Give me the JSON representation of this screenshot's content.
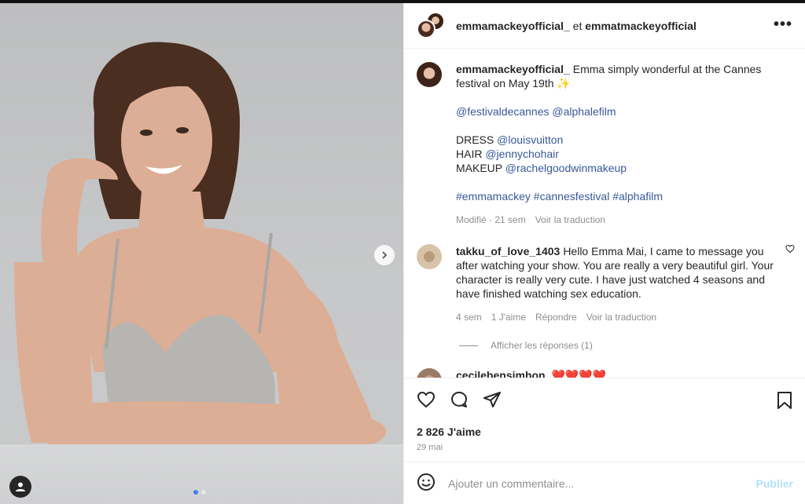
{
  "header": {
    "user1": "emmamackeyofficial_",
    "joiner": "et",
    "user2": "emmatmackeyofficial"
  },
  "caption": {
    "username": "emmamackeyofficial_",
    "text": "Emma simply wonderful at the Cannes festival on May 19th ✨",
    "mentions_line": [
      "@festivaldecannes",
      "@alphalefilm"
    ],
    "credits": [
      {
        "label": "DRESS",
        "handle": "@louisvuitton"
      },
      {
        "label": "HAIR",
        "handle": "@jennychohair"
      },
      {
        "label": "MAKEUP",
        "handle": "@rachelgoodwinmakeup"
      }
    ],
    "hashtags": "#emmamackey #cannesfestival #alphafilm",
    "edited": "Modifié · 21 sem",
    "translate": "Voir la traduction"
  },
  "comment1": {
    "username": "takku_of_love_1403",
    "text": "Hello Emma Mai, I came to message you after watching your show. You are really a very beautiful girl. Your character is really very cute. I have just watched 4 seasons and have finished watching sex education.",
    "age": "4 sem",
    "likes": "1 J'aime",
    "reply": "Répondre",
    "translate": "Voir la traduction",
    "view_replies": "Afficher les réponses (1)"
  },
  "comment2": {
    "username": "cecilebensimhon",
    "text": "❤️❤️❤️❤️"
  },
  "post": {
    "likes": "2 826 J'aime",
    "date": "29 mai"
  },
  "comment_input": {
    "placeholder": "Ajouter un commentaire...",
    "publish": "Publier"
  },
  "icons": [
    "heart-icon",
    "comment-icon",
    "share-icon",
    "bookmark-icon",
    "emoji-icon",
    "more-icon",
    "next-arrow-icon",
    "user-tag-icon"
  ]
}
